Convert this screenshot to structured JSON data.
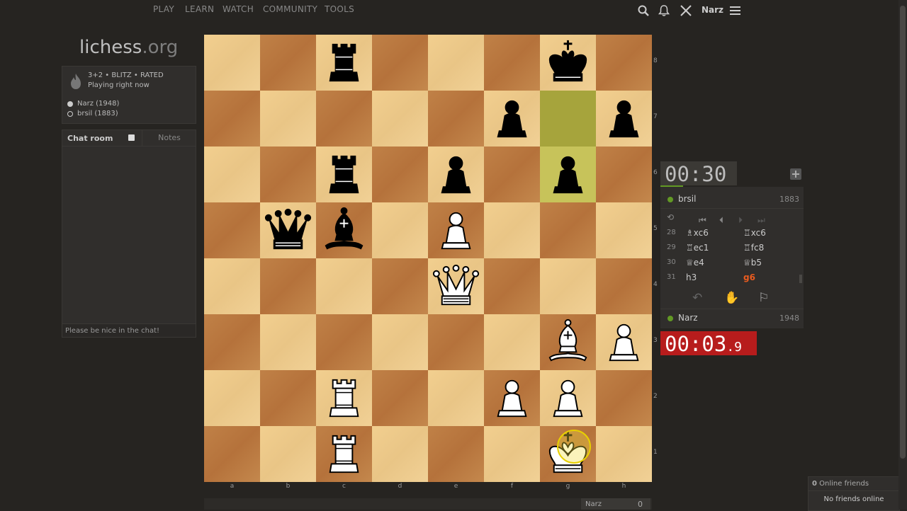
{
  "nav": {
    "items": [
      "PLAY",
      "LEARN",
      "WATCH",
      "COMMUNITY",
      "TOOLS"
    ],
    "username": "Narz"
  },
  "logo": {
    "main": "lichess",
    "suffix": ".org"
  },
  "game_info": {
    "mode": "3+2 • BLITZ • RATED",
    "status": "Playing right now",
    "white_player": "Narz (1948)",
    "black_player": "brsil (1883)"
  },
  "chat": {
    "tab_chat": "Chat room",
    "tab_notes": "Notes",
    "placeholder": "Please be nice in the chat!"
  },
  "board": {
    "files": [
      "a",
      "b",
      "c",
      "d",
      "e",
      "f",
      "g",
      "h"
    ],
    "ranks": [
      "8",
      "7",
      "6",
      "5",
      "4",
      "3",
      "2",
      "1"
    ],
    "highlight": [
      "g7",
      "g6"
    ],
    "pieces": [
      {
        "sq": "c8",
        "p": "r"
      },
      {
        "sq": "g8",
        "p": "k"
      },
      {
        "sq": "f7",
        "p": "p"
      },
      {
        "sq": "h7",
        "p": "p"
      },
      {
        "sq": "c6",
        "p": "r"
      },
      {
        "sq": "e6",
        "p": "p"
      },
      {
        "sq": "g6",
        "p": "p"
      },
      {
        "sq": "b5",
        "p": "q"
      },
      {
        "sq": "c5",
        "p": "b"
      },
      {
        "sq": "e5",
        "p": "P"
      },
      {
        "sq": "e4",
        "p": "Q"
      },
      {
        "sq": "g3",
        "p": "B"
      },
      {
        "sq": "h3",
        "p": "P"
      },
      {
        "sq": "c2",
        "p": "R"
      },
      {
        "sq": "f2",
        "p": "P"
      },
      {
        "sq": "g2",
        "p": "P"
      },
      {
        "sq": "c1",
        "p": "R"
      },
      {
        "sq": "g1",
        "p": "K"
      }
    ]
  },
  "clock_top": {
    "time": "00:30"
  },
  "clock_bottom": {
    "time": "00:03",
    "tenths": ".9"
  },
  "top_player": {
    "name": "brsil",
    "rating": "1883"
  },
  "bottom_player": {
    "name": "Narz",
    "rating": "1948"
  },
  "moves": [
    {
      "num": "28",
      "white": "♗xc6",
      "black": "♖xc6"
    },
    {
      "num": "29",
      "white": "♖ec1",
      "black": "♖fc8"
    },
    {
      "num": "30",
      "white": "♕e4",
      "black": "♕b5"
    },
    {
      "num": "31",
      "white": "h3",
      "black": "g6"
    }
  ],
  "friends": {
    "count": "0",
    "label": " Online friends",
    "none": "No friends online"
  },
  "bottom": {
    "name": "Narz",
    "score": "0"
  }
}
